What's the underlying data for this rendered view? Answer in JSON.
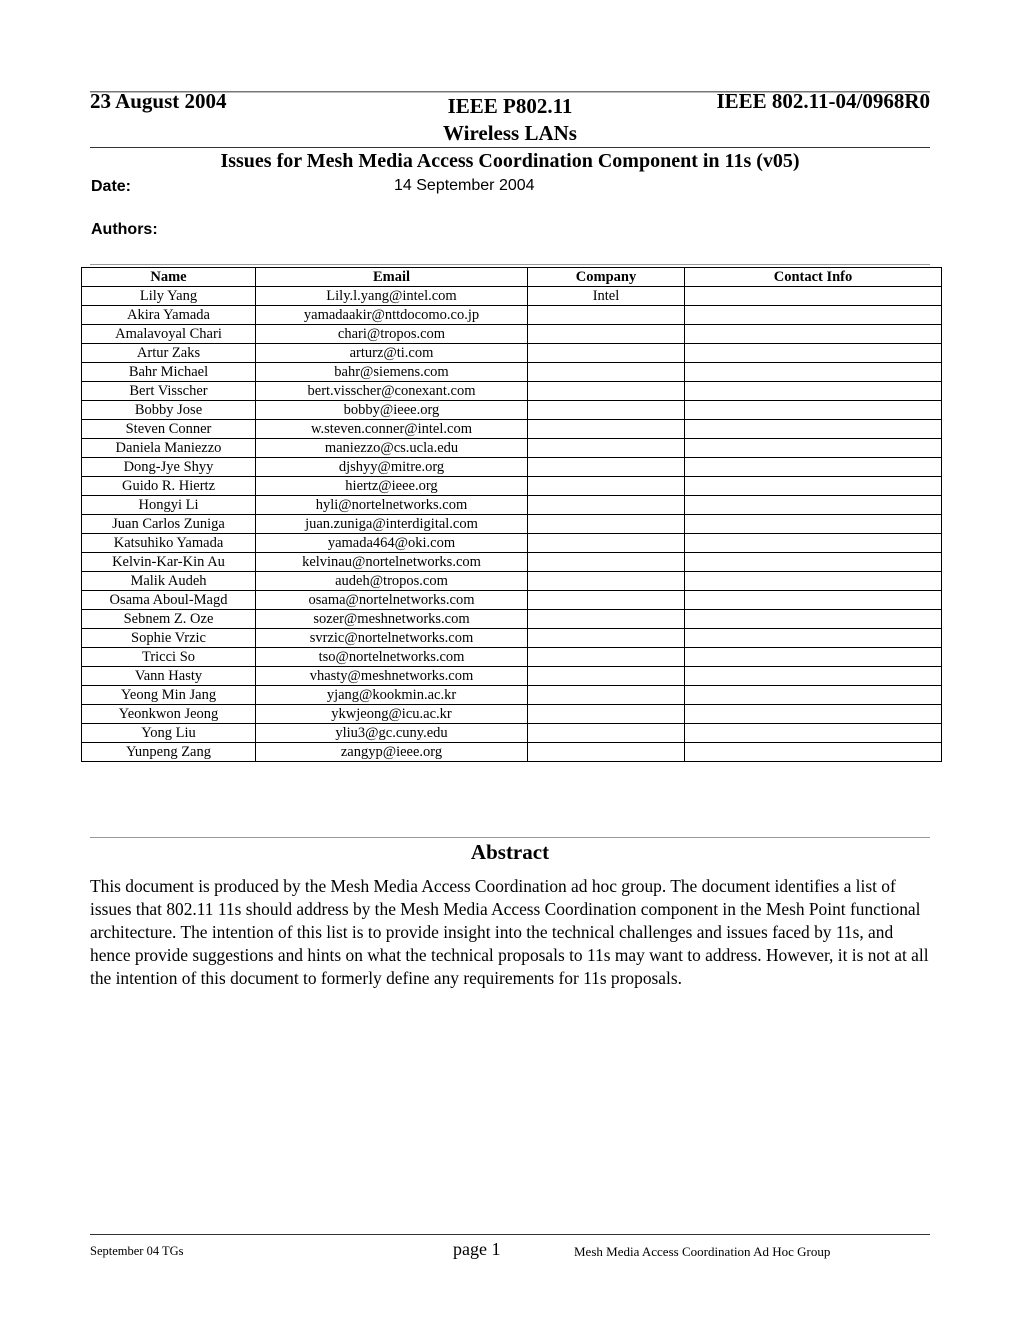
{
  "header": {
    "date": "23 August 2004",
    "doc_number": "IEEE 802.11-04/0968R0"
  },
  "title_block": {
    "line1": "IEEE P802.11",
    "line2": "Wireless LANs",
    "doc_title": "Issues for Mesh Media Access Coordination Component in 11s (v05)",
    "date_label": "Date:",
    "date_value": "14 September 2004",
    "authors_label": "Authors:"
  },
  "authors_table": {
    "columns": [
      "Name",
      "Email",
      "Company",
      "Contact Info"
    ],
    "rows": [
      {
        "name": "Lily Yang",
        "email": "Lily.l.yang@intel.com",
        "company": "Intel",
        "contact": ""
      },
      {
        "name": "Akira Yamada",
        "email": "yamadaakir@nttdocomo.co.jp",
        "company": "",
        "contact": ""
      },
      {
        "name": "Amalavoyal Chari",
        "email": "chari@tropos.com",
        "company": "",
        "contact": ""
      },
      {
        "name": "Artur Zaks",
        "email": "arturz@ti.com",
        "company": "",
        "contact": ""
      },
      {
        "name": "Bahr Michael",
        "email": "bahr@siemens.com",
        "company": "",
        "contact": ""
      },
      {
        "name": "Bert Visscher",
        "email": "bert.visscher@conexant.com",
        "company": "",
        "contact": ""
      },
      {
        "name": "Bobby Jose",
        "email": "bobby@ieee.org",
        "company": "",
        "contact": ""
      },
      {
        "name": "Steven Conner",
        "email": "w.steven.conner@intel.com",
        "company": "",
        "contact": ""
      },
      {
        "name": "Daniela Maniezzo",
        "email": "maniezzo@cs.ucla.edu",
        "company": "",
        "contact": ""
      },
      {
        "name": "Dong-Jye Shyy",
        "email": "djshyy@mitre.org",
        "company": "",
        "contact": ""
      },
      {
        "name": "Guido R. Hiertz",
        "email": "hiertz@ieee.org",
        "company": "",
        "contact": ""
      },
      {
        "name": "Hongyi Li",
        "email": "hyli@nortelnetworks.com",
        "company": "",
        "contact": ""
      },
      {
        "name": "Juan Carlos Zuniga",
        "email": "juan.zuniga@interdigital.com",
        "company": "",
        "contact": ""
      },
      {
        "name": "Katsuhiko Yamada",
        "email": "yamada464@oki.com",
        "company": "",
        "contact": ""
      },
      {
        "name": "Kelvin-Kar-Kin Au",
        "email": "kelvinau@nortelnetworks.com",
        "company": "",
        "contact": ""
      },
      {
        "name": "Malik Audeh",
        "email": "audeh@tropos.com",
        "company": "",
        "contact": ""
      },
      {
        "name": "Osama Aboul-Magd",
        "email": "osama@nortelnetworks.com",
        "company": "",
        "contact": ""
      },
      {
        "name": "Sebnem Z. Oze",
        "email": "sozer@meshnetworks.com",
        "company": "",
        "contact": ""
      },
      {
        "name": "Sophie Vrzic",
        "email": "svrzic@nortelnetworks.com",
        "company": "",
        "contact": ""
      },
      {
        "name": "Tricci So",
        "email": "tso@nortelnetworks.com",
        "company": "",
        "contact": ""
      },
      {
        "name": "Vann Hasty",
        "email": "vhasty@meshnetworks.com",
        "company": "",
        "contact": ""
      },
      {
        "name": "Yeong Min Jang",
        "email": "yjang@kookmin.ac.kr",
        "company": "",
        "contact": ""
      },
      {
        "name": "Yeonkwon Jeong",
        "email": "ykwjeong@icu.ac.kr",
        "company": "",
        "contact": ""
      },
      {
        "name": "Yong Liu",
        "email": "yliu3@gc.cuny.edu",
        "company": "",
        "contact": ""
      },
      {
        "name": "Yunpeng Zang",
        "email": "zangyp@ieee.org",
        "company": "",
        "contact": ""
      }
    ]
  },
  "abstract": {
    "title": "Abstract",
    "body": "This document is produced by the Mesh Media Access Coordination ad hoc group. The document identifies a list of issues that 802.11 11s should address by the Mesh Media Access Coordination component in the Mesh Point functional architecture. The intention of this list is to provide insight into the technical challenges and issues faced by 11s, and hence provide suggestions and hints on what the technical proposals to 11s may want to address. However, it is not at all the intention of this document to formerly define any requirements for 11s proposals."
  },
  "footer": {
    "left": "September 04 TGs",
    "page": "page 1",
    "right": "Mesh Media Access Coordination Ad Hoc Group"
  }
}
